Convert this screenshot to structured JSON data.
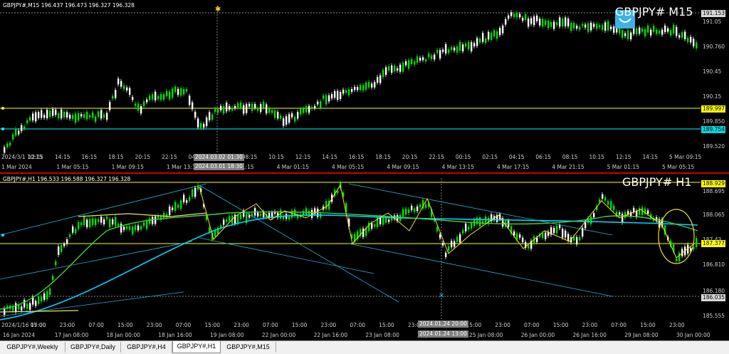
{
  "colors": {
    "bull": "#00e000",
    "bear": "#ffffff",
    "level_yellow": "#ffff00",
    "level_cyan": "#00ffff",
    "trend_blue": "#1eb4e0",
    "ma_green": "#3cd23c",
    "ma_cyan": "#00d2ff",
    "ma_yellow": "#f0e060"
  },
  "chart1": {
    "info": "GBPJPY#,M15  196.437 196.473 196.327 196.328",
    "title": "GBPJPY# M15",
    "price_ticks": [
      "191.05",
      "190.760",
      "190.45",
      "190.15",
      "189.850",
      "189.520"
    ],
    "badge_top": "191.153",
    "badge_yellow": "189.997",
    "badge_cyan": "189.754",
    "time_labels": [
      "2024/3/1 10:15",
      "12:15",
      "14:15",
      "16:15",
      "18:15",
      "20:15",
      "22:15",
      "04:15",
      "06:15",
      "08:15",
      "10:15",
      "12:15",
      "14:15",
      "16:15",
      "18:15",
      "20:15",
      "22:15",
      "00:15",
      "02:15",
      "04:15",
      "06:15",
      "08:15",
      "10:15",
      "12:15",
      "14:15",
      "5 Mar 09:15"
    ],
    "sub_labels": [
      "1 Mar 2024",
      "1 Mar 05:15",
      "1 Mar 09:15",
      "1 Mar 13:15",
      "1 Mar 21:15",
      "4 Mar 01:15",
      "4 Mar 05:15",
      "4 Mar 09:15",
      "4 Mar 13:15",
      "4 Mar 17:15",
      "4 Mar 21:15",
      "5 Mar 01:15",
      "5 Mar 05:15"
    ],
    "cursor_label_1": "2024.03.02 01:30",
    "cursor_label_2": "2024.03.01 18:30"
  },
  "chart2": {
    "info": "GBPJPY#,H1  196.533 196.588 196.327 196.328",
    "title": "GBPJPY# H1",
    "price_ticks": [
      "188.695",
      "188.065",
      "187.43",
      "186.810",
      "186.180",
      "185.555"
    ],
    "badge_top": "188.929",
    "badge_yellow": "187.377",
    "badge_gray": "186.035",
    "time_labels": [
      "16 Jan 2024",
      "17 Jan 08:00",
      "18 Jan 00:00",
      "18 Jan 16:00",
      "19 Jan 08:00",
      "22 Jan 00:00",
      "22 Jan 16:00",
      "23 Jan 08:00",
      "24 Jan 00:00",
      "25 Jan 08:00",
      "26 Jan 00:00",
      "26 Jan 16:00",
      "29 Jan 08:00",
      "30 Jan 00:00"
    ],
    "sub_labels": [
      "2024/1/16 07:00",
      "15:00",
      "23:00",
      "07:00",
      "15:00",
      "23:00",
      "07:00",
      "15:00",
      "23:00",
      "07:00",
      "15:00",
      "23:00",
      "07:00",
      "15:00",
      "23:00",
      "07:00",
      "15:00",
      "23:00",
      "07:00",
      "15:00",
      "23:00",
      "07:00",
      "15:00",
      "23:00"
    ],
    "cursor_label_1": "2024.01.24 20:00",
    "cursor_label_2": "2024.01.24 13:00"
  },
  "tabs": [
    {
      "label": "GBPJPY#,Weekly",
      "active": false
    },
    {
      "label": "GBPJPY#,Daily",
      "active": false
    },
    {
      "label": "GBPJPY#,H4",
      "active": false
    },
    {
      "label": "GBPJPY#,H1",
      "active": true
    },
    {
      "label": "GBPJPY#,M15",
      "active": false
    }
  ]
}
